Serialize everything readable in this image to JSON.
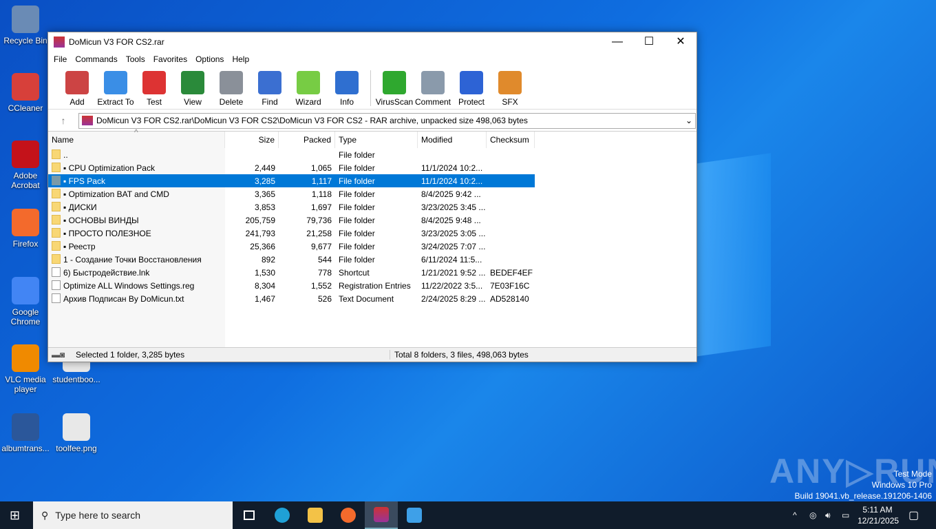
{
  "desktop": {
    "icons": [
      "Recycle Bin",
      "CCleaner",
      "Adobe Acrobat",
      "Firefox",
      "Google Chrome",
      "VLC media player",
      "studentboo...",
      "albumtrans...",
      "toolfee.png"
    ]
  },
  "window": {
    "title": "DoMicun V3 FOR CS2.rar",
    "controls": {
      "minimize": "—",
      "maximize": "☐",
      "close": "✕"
    }
  },
  "menu": [
    "File",
    "Commands",
    "Tools",
    "Favorites",
    "Options",
    "Help"
  ],
  "toolbar": [
    {
      "label": "Add",
      "icon": "add-icon",
      "color": "#c44"
    },
    {
      "label": "Extract To",
      "icon": "extract-folder-icon",
      "color": "#3a8ee6"
    },
    {
      "label": "Test",
      "icon": "test-clipboard-icon",
      "color": "#d33"
    },
    {
      "label": "View",
      "icon": "view-book-icon",
      "color": "#2a8a3a"
    },
    {
      "label": "Delete",
      "icon": "delete-bin-icon",
      "color": "#8a9099"
    },
    {
      "label": "Find",
      "icon": "find-magnifier-icon",
      "color": "#3b6fd1"
    },
    {
      "label": "Wizard",
      "icon": "wizard-wand-icon",
      "color": "#7c4"
    },
    {
      "label": "Info",
      "icon": "info-icon",
      "color": "#2f6fd0"
    },
    {
      "label": "VirusScan",
      "icon": "virusscan-icon",
      "color": "#2fa82f"
    },
    {
      "label": "Comment",
      "icon": "comment-icon",
      "color": "#8a9aab"
    },
    {
      "label": "Protect",
      "icon": "protect-shield-icon",
      "color": "#2d63d5"
    },
    {
      "label": "SFX",
      "icon": "sfx-box-icon",
      "color": "#e08a2c"
    }
  ],
  "address": {
    "up": "↑",
    "path": "DoMicun V3 FOR CS2.rar\\DoMicun V3 FOR CS2\\DoMicun V3 FOR CS2 - RAR archive, unpacked size 498,063 bytes",
    "dropdown": "⌄"
  },
  "columns": [
    "Name",
    "Size",
    "Packed",
    "Type",
    "Modified",
    "Checksum"
  ],
  "sort_indicator": "^",
  "files": [
    {
      "name": "..",
      "size": "",
      "packed": "",
      "type": "File folder",
      "modified": "",
      "checksum": "",
      "kind": "folder"
    },
    {
      "name": "▪ CPU Optimization Pack",
      "size": "2,449",
      "packed": "1,065",
      "type": "File folder",
      "modified": "11/1/2024 10:2...",
      "checksum": "",
      "kind": "folder"
    },
    {
      "name": "▪ FPS Pack",
      "size": "3,285",
      "packed": "1,117",
      "type": "File folder",
      "modified": "11/1/2024 10:2...",
      "checksum": "",
      "kind": "folder",
      "selected": true
    },
    {
      "name": "▪ Optimization BAT and CMD",
      "size": "3,365",
      "packed": "1,118",
      "type": "File folder",
      "modified": "8/4/2025 9:42 ...",
      "checksum": "",
      "kind": "folder"
    },
    {
      "name": "▪ ДИСКИ",
      "size": "3,853",
      "packed": "1,697",
      "type": "File folder",
      "modified": "3/23/2025 3:45 ...",
      "checksum": "",
      "kind": "folder"
    },
    {
      "name": "▪ ОСНОВЫ ВИНДЫ",
      "size": "205,759",
      "packed": "79,736",
      "type": "File folder",
      "modified": "8/4/2025 9:48 ...",
      "checksum": "",
      "kind": "folder"
    },
    {
      "name": "▪ ПРОСТО ПОЛЕЗНОЕ",
      "size": "241,793",
      "packed": "21,258",
      "type": "File folder",
      "modified": "3/23/2025 3:05 ...",
      "checksum": "",
      "kind": "folder"
    },
    {
      "name": "▪ Реестр",
      "size": "25,366",
      "packed": "9,677",
      "type": "File folder",
      "modified": "3/24/2025 7:07 ...",
      "checksum": "",
      "kind": "folder"
    },
    {
      "name": "1 - Создание Точки Восстановления",
      "size": "892",
      "packed": "544",
      "type": "File folder",
      "modified": "6/11/2024 11:5...",
      "checksum": "",
      "kind": "folder"
    },
    {
      "name": "6) Быстродействие.lnk",
      "size": "1,530",
      "packed": "778",
      "type": "Shortcut",
      "modified": "1/21/2021 9:52 ...",
      "checksum": "BEDEF4EF",
      "kind": "file"
    },
    {
      "name": "Optimize ALL Windows Settings.reg",
      "size": "8,304",
      "packed": "1,552",
      "type": "Registration Entries",
      "modified": "11/22/2022 3:5...",
      "checksum": "7E03F16C",
      "kind": "file"
    },
    {
      "name": "Архив Подписан By DoMicun.txt",
      "size": "1,467",
      "packed": "526",
      "type": "Text Document",
      "modified": "2/24/2025 8:29 ...",
      "checksum": "AD528140",
      "kind": "file"
    }
  ],
  "status": {
    "left": "Selected 1 folder, 3,285 bytes",
    "right": "Total 8 folders, 3 files, 498,063 bytes"
  },
  "taskbar": {
    "search_placeholder": "Type here to search",
    "time": "5:11 AM",
    "date": "12/21/2025",
    "tray_chevron": "^"
  },
  "watermark": {
    "brand": "ANY RUN",
    "line1": "Test Mode",
    "line2": "Windows 10 Pro",
    "line3": "Build 19041.vb_release.191206-1406"
  }
}
